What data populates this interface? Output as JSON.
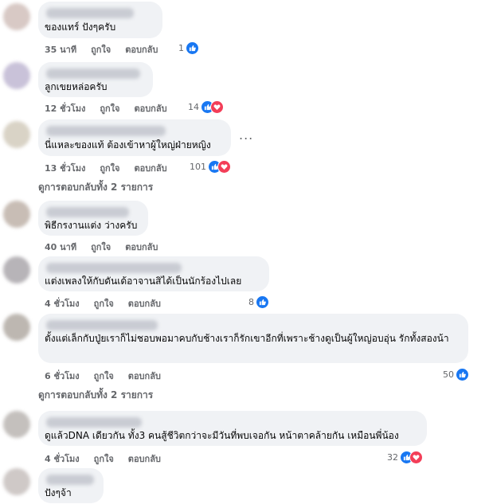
{
  "comments": [
    {
      "text": "ของแทร์ ปังๆครับ",
      "time": "35 นาที",
      "like_label": "ถูกใจ",
      "reply_label": "ตอบกลับ",
      "reaction_count": "1",
      "reactions": [
        "like-icon"
      ]
    },
    {
      "text": "ลูกเขยหล่อครับ",
      "time": "12 ชั่วโมง",
      "like_label": "ถูกใจ",
      "reply_label": "ตอบกลับ",
      "reaction_count": "14",
      "reactions": [
        "like-icon",
        "heart-icon"
      ]
    },
    {
      "text": "นี่แหละของแท้ ต้องเข้าหาผู้ใหญ่ฝ่ายหญิง",
      "time": "13 ชั่วโมง",
      "like_label": "ถูกใจ",
      "reply_label": "ตอบกลับ",
      "reaction_count": "101",
      "reactions": [
        "like-icon",
        "heart-icon"
      ],
      "more": "...",
      "view_replies": "ดูการตอบกลับทั้ง 2 รายการ"
    },
    {
      "text": "พิธีกรงานแต่ง ว่างครับ",
      "time": "40 นาที",
      "like_label": "ถูกใจ",
      "reply_label": "ตอบกลับ"
    },
    {
      "text": "แต่งเพลงให้กับดันเด้อาจานสิได้เป็นนักร้องไปเลย",
      "time": "4 ชั่วโมง",
      "like_label": "ถูกใจ",
      "reply_label": "ตอบกลับ",
      "reaction_count": "8",
      "reactions": [
        "like-icon"
      ]
    },
    {
      "text": "ตั้งแต่เล็กกับปู่ยเราก็ไม่ชอบพอมาคบกับช้างเราก็รักเขาอีกที่เพราะช้างดูเป็นผู้ใหญ่อบอุ่น รักทั้งสองน้า",
      "time": "6 ชั่วโมง",
      "like_label": "ถูกใจ",
      "reply_label": "ตอบกลับ",
      "reaction_count": "50",
      "reactions": [
        "like-icon"
      ],
      "view_replies": "ดูการตอบกลับทั้ง 2 รายการ"
    },
    {
      "text": "ดูแล้วDNA เดียวกัน ทั้ง3 คนสู้ชีวิตกว่าจะมีวันที่พบเจอกัน หน้าตาคล้ายกัน เหมือนพี่น้อง",
      "time": "4 ชั่วโมง",
      "like_label": "ถูกใจ",
      "reply_label": "ตอบกลับ",
      "reaction_count": "32",
      "reactions": [
        "like-icon",
        "heart-icon"
      ]
    },
    {
      "text": "ปังๆจ้า"
    }
  ],
  "colors": {
    "bubble": "#f0f2f5",
    "like": "#1877f2",
    "love": "#f33e58",
    "meta": "#65676b"
  }
}
